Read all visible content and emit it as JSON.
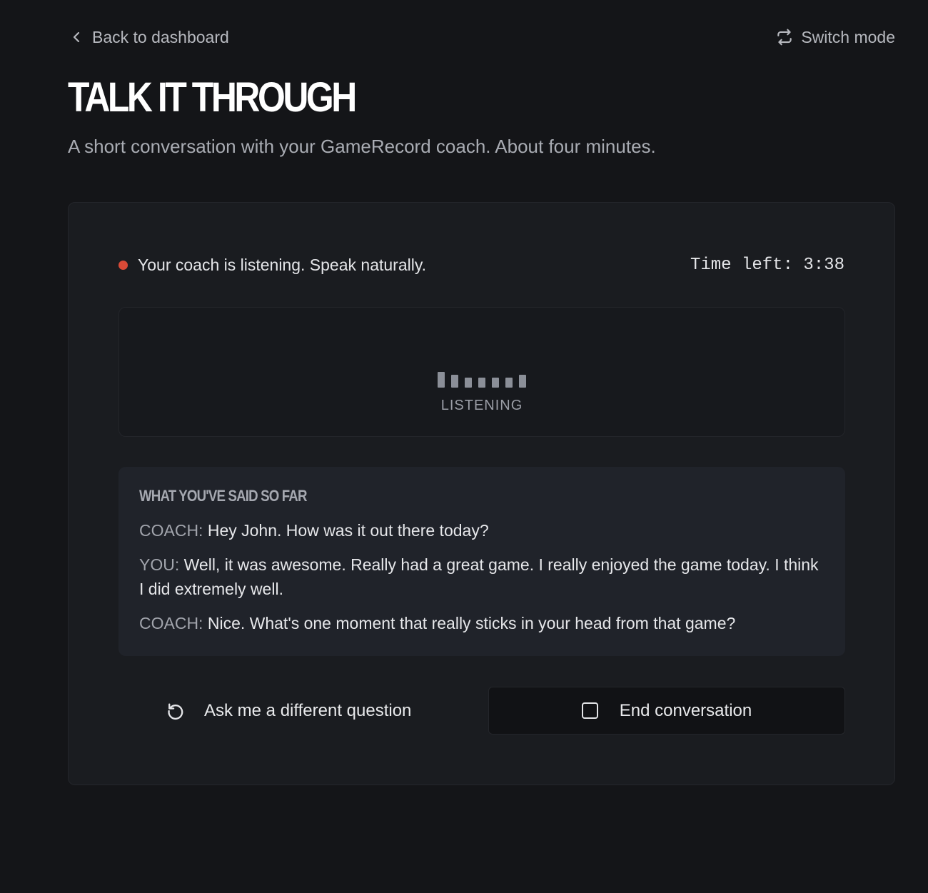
{
  "nav": {
    "back_label": "Back to dashboard",
    "switch_label": "Switch mode"
  },
  "header": {
    "title": "TALK IT THROUGH",
    "subtitle": "A short conversation with your GameRecord coach. About four minutes."
  },
  "status": {
    "message": "Your coach is listening. Speak naturally.",
    "timer": "Time left: 3:38",
    "indicator_color": "#d84a37"
  },
  "listening": {
    "label": "LISTENING"
  },
  "transcript": {
    "heading": "WHAT YOU'VE SAID SO FAR",
    "lines": [
      {
        "speaker": "COACH:",
        "text": " Hey John. How was it out there today?"
      },
      {
        "speaker": "YOU:",
        "text": " Well, it was awesome. Really had a great game. I really enjoyed the game today. I think I did extremely well."
      },
      {
        "speaker": "COACH:",
        "text": " Nice. What's one moment that really sticks in your head from that game?"
      }
    ]
  },
  "actions": {
    "ask_label": "Ask me a different question",
    "end_label": "End conversation"
  }
}
